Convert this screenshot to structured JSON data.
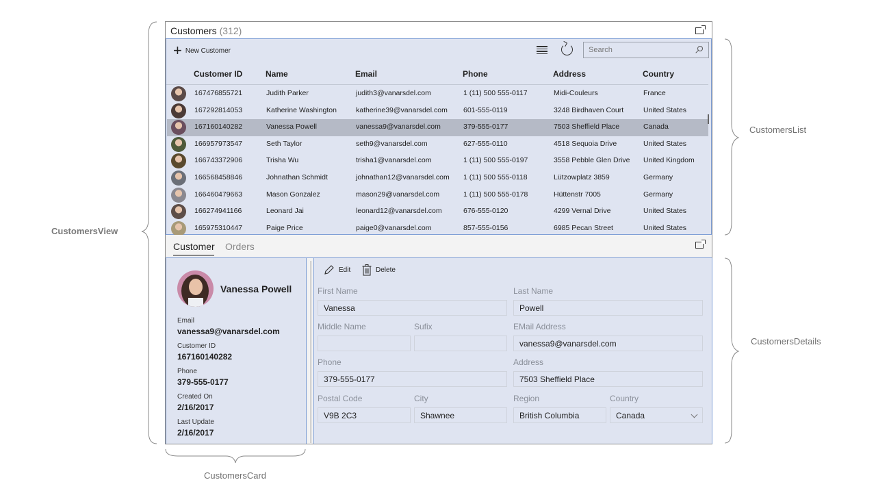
{
  "annotations": {
    "customers_view": "CustomersView",
    "customers_list": "CustomersList",
    "customers_details": "CustomersDetails",
    "customers_card": "CustomersCard"
  },
  "list": {
    "title": "Customers",
    "count": "(312)",
    "new_customer_label": "New Customer",
    "search_placeholder": "Search",
    "icons": [
      "plus-icon",
      "list-view-icon",
      "refresh-icon",
      "search-icon",
      "popout-icon"
    ],
    "columns": [
      "Customer ID",
      "Name",
      "Email",
      "Phone",
      "Address",
      "Country"
    ],
    "rows": [
      {
        "id": "167476855721",
        "name": "Judith Parker",
        "email": "judith3@vanarsdel.com",
        "phone": "1 (11) 500 555-0117",
        "address": "Midi-Couleurs",
        "country": "France",
        "selected": false,
        "avatar_color": "#5a4a48"
      },
      {
        "id": "167292814053",
        "name": "Katherine Washington",
        "email": "katherine39@vanarsdel.com",
        "phone": "601-555-0119",
        "address": "3248 Birdhaven Court",
        "country": "United States",
        "selected": false,
        "avatar_color": "#4b3a36"
      },
      {
        "id": "167160140282",
        "name": "Vanessa Powell",
        "email": "vanessa9@vanarsdel.com",
        "phone": "379-555-0177",
        "address": "7503 Sheffield Place",
        "country": "Canada",
        "selected": true,
        "avatar_color": "#6a4e5e"
      },
      {
        "id": "166957973547",
        "name": "Seth Taylor",
        "email": "seth9@vanarsdel.com",
        "phone": "627-555-0110",
        "address": "4518 Sequoia Drive",
        "country": "United States",
        "selected": false,
        "avatar_color": "#4e5a3a"
      },
      {
        "id": "166743372906",
        "name": "Trisha Wu",
        "email": "trisha1@vanarsdel.com",
        "phone": "1 (11) 500 555-0197",
        "address": "3558 Pebble Glen Drive",
        "country": "United Kingdom",
        "selected": false,
        "avatar_color": "#5a4a2e"
      },
      {
        "id": "166568458846",
        "name": "Johnathan Schmidt",
        "email": "johnathan12@vanarsdel.com",
        "phone": "1 (11) 500 555-0118",
        "address": "Lützowplatz 3859",
        "country": "Germany",
        "selected": false,
        "avatar_color": "#6b6f78"
      },
      {
        "id": "166460479663",
        "name": "Mason Gonzalez",
        "email": "mason29@vanarsdel.com",
        "phone": "1 (11) 500 555-0178",
        "address": "Hüttenstr 7005",
        "country": "Germany",
        "selected": false,
        "avatar_color": "#8a8890"
      },
      {
        "id": "166274941166",
        "name": "Leonard Jai",
        "email": "leonard12@vanarsdel.com",
        "phone": "676-555-0120",
        "address": "4299 Vernal Drive",
        "country": "United States",
        "selected": false,
        "avatar_color": "#5e4e48"
      },
      {
        "id": "165975310447",
        "name": "Paige Price",
        "email": "paige0@vanarsdel.com",
        "phone": "857-555-0156",
        "address": "6985 Pecan Street",
        "country": "United States",
        "selected": false,
        "avatar_color": "#a89a78"
      }
    ]
  },
  "details": {
    "tabs": [
      "Customer",
      "Orders"
    ],
    "active_tab": "Customer",
    "card": {
      "name": "Vanessa Powell",
      "email_label": "Email",
      "email": "vanessa9@vanarsdel.com",
      "customer_id_label": "Customer ID",
      "customer_id": "167160140282",
      "phone_label": "Phone",
      "phone": "379-555-0177",
      "created_on_label": "Created On",
      "created_on": "2/16/2017",
      "last_update_label": "Last Update",
      "last_update": "2/16/2017"
    },
    "form": {
      "edit_label": "Edit",
      "delete_label": "Delete",
      "first_name_label": "First Name",
      "first_name": "Vanessa",
      "last_name_label": "Last Name",
      "last_name": "Powell",
      "middle_name_label": "Middle Name",
      "middle_name": "",
      "suffix_label": "Sufix",
      "suffix": "",
      "email_label": "EMail Address",
      "email": "vanessa9@vanarsdel.com",
      "phone_label": "Phone",
      "phone": "379-555-0177",
      "address_label": "Address",
      "address": "7503 Sheffield Place",
      "postal_code_label": "Postal Code",
      "postal_code": "V9B 2C3",
      "city_label": "City",
      "city": "Shawnee",
      "region_label": "Region",
      "region": "British Columbia",
      "country_label": "Country",
      "country": "Canada"
    }
  }
}
